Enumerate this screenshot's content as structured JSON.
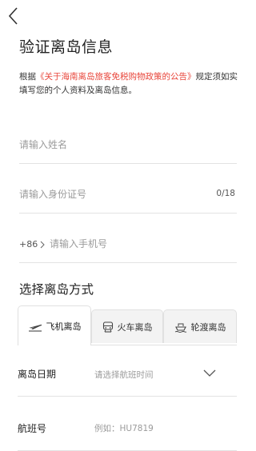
{
  "header": {
    "back_icon": "chevron-left-icon",
    "title": "验证离岛信息"
  },
  "notice": {
    "prefix": "根据",
    "link": "《关于海南离岛旅客免税购物政策的公告》",
    "suffix": "规定须如实填写您的个人资料及离岛信息。"
  },
  "form": {
    "name_placeholder": "请输入姓名",
    "id_placeholder": "请输入身份证号",
    "id_counter": "0/18",
    "phone_prefix": "+86",
    "phone_placeholder": "请输入手机号"
  },
  "departure": {
    "section_title": "选择离岛方式",
    "tabs": [
      {
        "label": "飞机离岛",
        "icon": "plane-icon",
        "active": true
      },
      {
        "label": "火车离岛",
        "icon": "train-icon",
        "active": false
      },
      {
        "label": "轮渡离岛",
        "icon": "ferry-icon",
        "active": false
      }
    ],
    "date_label": "离岛日期",
    "date_placeholder": "请选择航班时间",
    "flight_label": "航班号",
    "flight_placeholder": "例如：HU7819"
  },
  "colors": {
    "link": "#e8463b",
    "divider": "#e3e3e3",
    "placeholder": "#9b9b9b"
  }
}
